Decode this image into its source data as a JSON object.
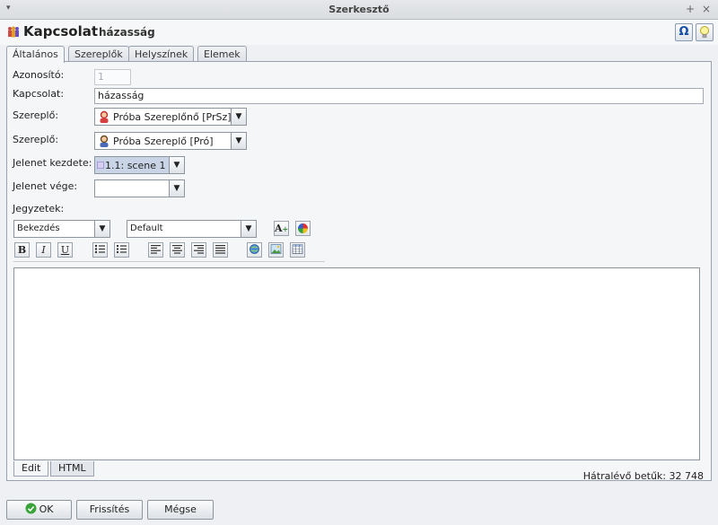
{
  "window": {
    "title": "Szerkesztő",
    "menu_glyph": "▾",
    "pin_glyph": "+",
    "close_glyph": "×"
  },
  "header": {
    "kind": "Kapcsolat",
    "name": "házasság",
    "omega_glyph": "Ω",
    "hint_icon": "lightbulb-icon",
    "entity_icon": "people-icon"
  },
  "tabs": [
    {
      "label": "Általános",
      "active": true
    },
    {
      "label": "Szereplők",
      "active": false
    },
    {
      "label": "Helyszínek",
      "active": false
    },
    {
      "label": "Elemek",
      "active": false
    }
  ],
  "form": {
    "id_label": "Azonosító:",
    "id_value": "1",
    "relation_label": "Kapcsolat:",
    "relation_value": "házasság",
    "actor1_label": "Szereplő:",
    "actor1_value": "Próba Szereplőnő [PrSz]",
    "actor2_label": "Szereplő:",
    "actor2_value": "Próba Szereplő [Pró]",
    "scene_start_label": "Jelenet kezdete:",
    "scene_start_value": "1.1: scene 1",
    "scene_end_label": "Jelenet vége:",
    "scene_end_value": "",
    "notes_label": "Jegyzetek:"
  },
  "editor": {
    "paragraph_style": "Bekezdés",
    "font": "Default",
    "bold": "B",
    "italic": "I",
    "underline": "U",
    "tabs": [
      {
        "label": "Edit",
        "active": true
      },
      {
        "label": "HTML",
        "active": false
      }
    ],
    "remaining_label": "Hátralévő betűk: 32 748"
  },
  "buttons": {
    "ok": "OK",
    "refresh": "Frissítés",
    "cancel": "Mégse"
  },
  "colors": {
    "accent": "#3a6fc4",
    "ok_green": "#3aa33a",
    "selection": "#c9d5e6"
  }
}
